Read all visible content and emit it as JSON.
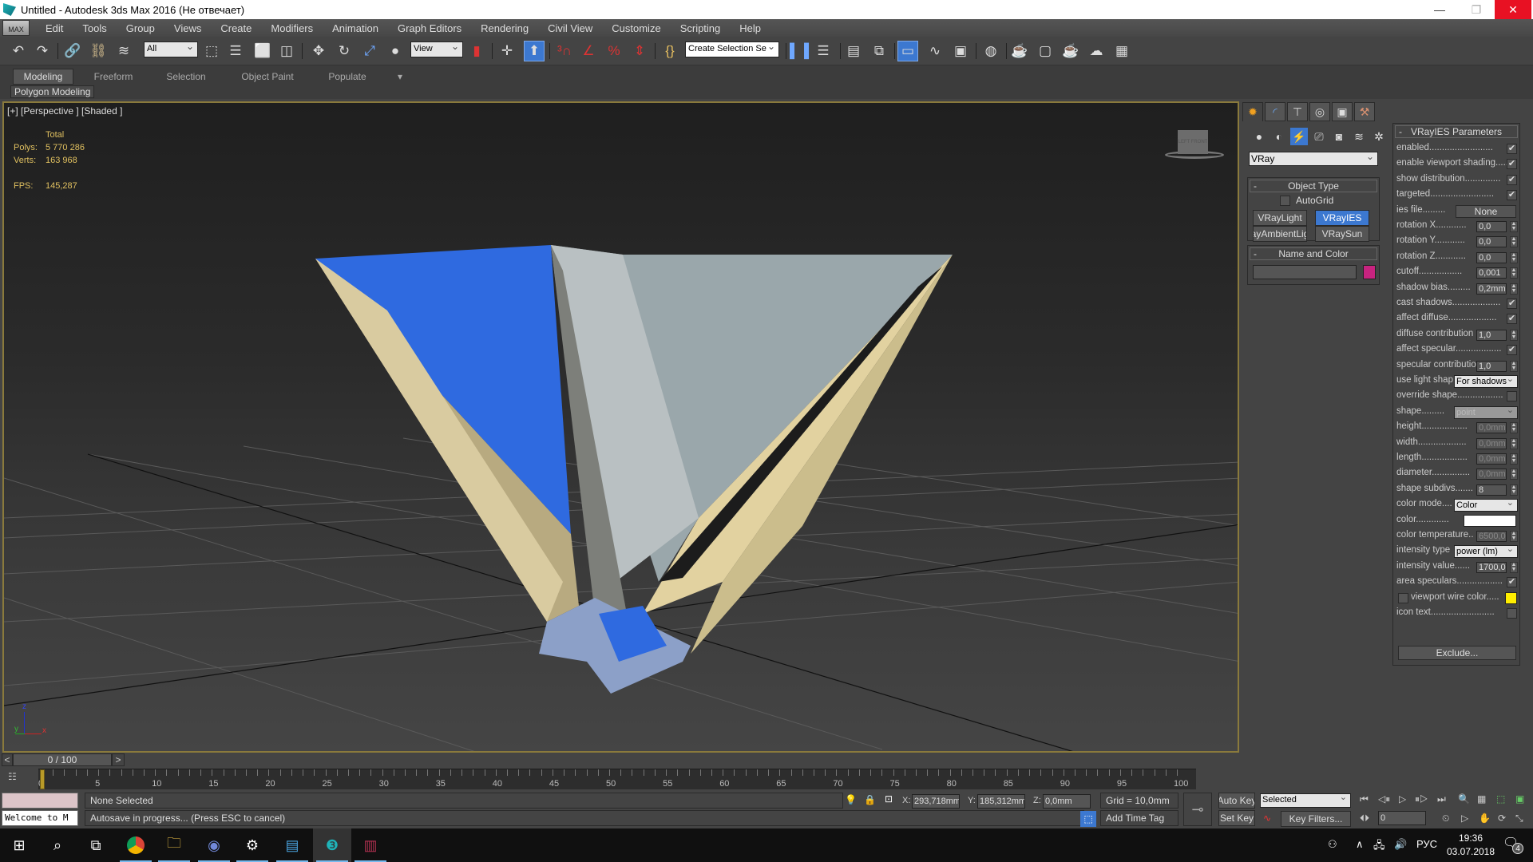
{
  "window": {
    "title": "Untitled - Autodesk 3ds Max 2016  (Не отвечает)",
    "controls": {
      "minimize": "—",
      "maximize": "❐",
      "close": "✕"
    }
  },
  "menubar": {
    "app_button": "MAX",
    "items": [
      "Edit",
      "Tools",
      "Group",
      "Views",
      "Create",
      "Modifiers",
      "Animation",
      "Graph Editors",
      "Rendering",
      "Civil View",
      "Customize",
      "Scripting",
      "Help"
    ]
  },
  "toolbar": {
    "selection_filter": "All",
    "reference_coord": "View",
    "named_selection_placeholder": "Create Selection Se",
    "icons": [
      "undo-icon",
      "redo-icon",
      "link-icon",
      "unlink-icon",
      "bind-space-warp-icon",
      "select-object-icon",
      "select-by-name-icon",
      "rect-selection-region-icon",
      "window-crossing-icon",
      "select-move-icon",
      "select-rotate-icon",
      "select-scale-icon",
      "select-place-icon",
      "pivot-center-icon",
      "manipulate-icon",
      "snaps-toggle-icon",
      "angle-snap-icon",
      "percent-snap-icon",
      "spinner-snap-icon",
      "edit-named-selection-icon",
      "mirror-icon",
      "align-icon",
      "scene-explorer-icon",
      "layer-explorer-icon",
      "toggle-ribbon-icon",
      "curve-editor-icon",
      "schematic-view-icon",
      "material-editor-icon",
      "render-setup-icon",
      "rendered-frame-window-icon",
      "render-production-icon",
      "render-iterative-icon",
      "render-in-cloud-icon"
    ]
  },
  "ribbon": {
    "tabs": [
      "Modeling",
      "Freeform",
      "Selection",
      "Object Paint",
      "Populate"
    ],
    "active_tab": "Modeling",
    "panel_label": "Polygon Modeling"
  },
  "viewport": {
    "label": "[+] [Perspective ] [Shaded ]",
    "stats": {
      "header": "Total",
      "polys_label": "Polys:",
      "polys": "5 770 286",
      "verts_label": "Verts:",
      "verts": "163 968",
      "fps_label": "FPS:",
      "fps": "145,287"
    },
    "viewcube": {
      "left": "LEFT",
      "front": "FRONT"
    },
    "axis": {
      "x": "x",
      "y": "y",
      "z": "z"
    },
    "colors": {
      "blue_face": "#2f6ae0",
      "beige_face": "#d9cba0",
      "grey_face": "#9aa7ab",
      "frame_border": "#8a7a3c"
    }
  },
  "command_panel": {
    "tabs": [
      "create-tab",
      "modify-tab",
      "hierarchy-tab",
      "motion-tab",
      "display-tab",
      "utilities-tab"
    ],
    "category_icons": [
      "geometry-icon",
      "shapes-icon",
      "lights-icon",
      "cameras-icon",
      "helpers-icon",
      "space-warps-icon",
      "systems-icon"
    ],
    "category_dropdown": "VRay",
    "object_type": {
      "title": "Object Type",
      "autogrid_label": "AutoGrid",
      "buttons": [
        "VRayLight",
        "VRayIES",
        "VRayAmbientLight",
        "VRaySun"
      ],
      "buttons_visible": [
        "VRayLight",
        "VRayIES",
        "ayAmbientLig",
        "VRaySun"
      ],
      "active": "VRayIES"
    },
    "name_and_color": {
      "title": "Name and Color",
      "name_value": "",
      "swatch_color": "#c8237f"
    }
  },
  "vrayies_params": {
    "title": "VRayIES Parameters",
    "rows": [
      {
        "label": "enabled.........................",
        "type": "check",
        "value": true
      },
      {
        "label": "enable viewport shading.....",
        "type": "check",
        "value": true
      },
      {
        "label": "show distribution..............",
        "type": "check",
        "value": true
      },
      {
        "label": "targeted.........................",
        "type": "check",
        "value": true
      },
      {
        "label": "ies file.........",
        "type": "button",
        "value": "None"
      },
      {
        "label": "rotation X............",
        "type": "spin",
        "value": "0,0"
      },
      {
        "label": "rotation Y............",
        "type": "spin",
        "value": "0,0"
      },
      {
        "label": "rotation Z............",
        "type": "spin",
        "value": "0,0"
      },
      {
        "label": "cutoff.................",
        "type": "spin",
        "value": "0,001"
      },
      {
        "label": "shadow bias.........",
        "type": "spin",
        "value": "0,2mm"
      },
      {
        "label": "cast shadows...................",
        "type": "check",
        "value": true
      },
      {
        "label": "affect diffuse...................",
        "type": "check",
        "value": true
      },
      {
        "label": "diffuse contribution",
        "type": "spin",
        "value": "1,0"
      },
      {
        "label": "affect specular..................",
        "type": "check",
        "value": true
      },
      {
        "label": "specular contributio",
        "type": "spin",
        "value": "1,0"
      },
      {
        "label": "use light shap",
        "type": "select",
        "value": "For shadows"
      },
      {
        "label": "override shape..................",
        "type": "check",
        "value": false
      },
      {
        "label": "shape.........",
        "type": "select-disabled",
        "value": "point"
      },
      {
        "label": "height..................",
        "type": "spin-disabled",
        "value": "0,0mm"
      },
      {
        "label": "width...................",
        "type": "spin-disabled",
        "value": "0,0mm"
      },
      {
        "label": "length..................",
        "type": "spin-disabled",
        "value": "0,0mm"
      },
      {
        "label": "diameter...............",
        "type": "spin-disabled",
        "value": "0,0mm"
      },
      {
        "label": "shape subdivs.......",
        "type": "spin",
        "value": "8"
      },
      {
        "label": "color mode....",
        "type": "select",
        "value": "Color"
      },
      {
        "label": "color.............",
        "type": "color",
        "value": "#ffffff"
      },
      {
        "label": "color temperature..",
        "type": "spin-disabled",
        "value": "6500,0"
      },
      {
        "label": "intensity type",
        "type": "select",
        "value": "power (lm)"
      },
      {
        "label": "intensity value......",
        "type": "spin",
        "value": "1700,0"
      },
      {
        "label": "area speculars..................",
        "type": "check",
        "value": true
      },
      {
        "label": "viewport wire color.....",
        "type": "wirecolor",
        "value": "#ffee00",
        "checked": false
      },
      {
        "label": "icon text.........................",
        "type": "check",
        "value": false
      }
    ],
    "exclude_button": "Exclude..."
  },
  "timeline": {
    "frame_display": "0 / 100",
    "prev": "<",
    "next": ">",
    "ticks": [
      "0",
      "5",
      "10",
      "15",
      "20",
      "25",
      "30",
      "35",
      "40",
      "45",
      "50",
      "55",
      "60",
      "65",
      "70",
      "75",
      "80",
      "85",
      "90",
      "95",
      "100"
    ],
    "current_frame": 0,
    "total_frames": 100
  },
  "status": {
    "maxscript_listener": "Welcome to M",
    "selection_status": "None Selected",
    "prompt": "Autosave in progress... (Press ESC to cancel)",
    "x_label": "X:",
    "x": "293,718mm",
    "y_label": "Y:",
    "y": "185,312mm",
    "z_label": "Z:",
    "z": "0,0mm",
    "grid": "Grid = 10,0mm",
    "add_time_tag": "Add Time Tag",
    "auto_key": "Auto Key",
    "set_key": "Set Key",
    "key_set_dropdown": "Selected",
    "key_filters": "Key Filters...",
    "current_frame_field": "0"
  },
  "taskbar": {
    "apps": [
      "start-button",
      "search-button",
      "task-view-button",
      "chrome-app",
      "file-explorer-app",
      "discord-app",
      "settings-app",
      "control-panel-app",
      "3dsmax-app",
      "winrar-app"
    ],
    "tray": {
      "language": "РУС",
      "time": "19:36",
      "date": "03.07.2018",
      "notifications": "4"
    }
  }
}
